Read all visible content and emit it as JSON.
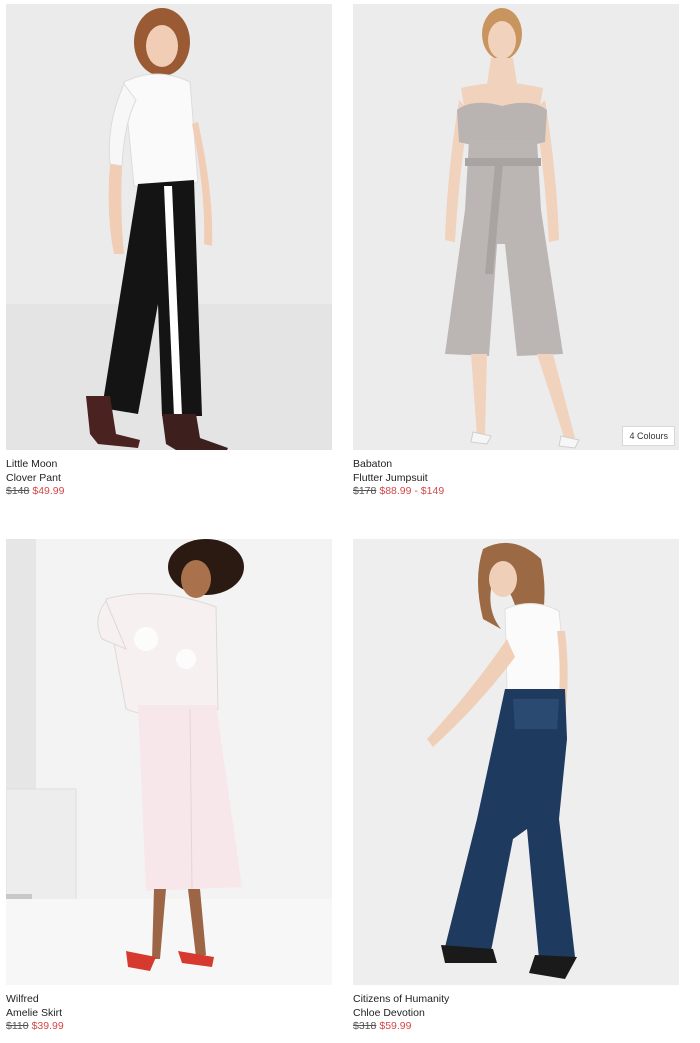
{
  "products": [
    {
      "brand": "Little Moon",
      "name": "Clover Pant",
      "old_price": "$148",
      "sale_price": "$49.99",
      "image_alt": "Woman in white knit sweater and black side-stripe wide-leg pants with brown ankle boots"
    },
    {
      "brand": "Babaton",
      "name": "Flutter Jumpsuit",
      "old_price": "$178",
      "sale_price": "$88.99 - $149",
      "badge": "4 Colours",
      "image_alt": "Woman in grey strapless ruffle jumpsuit with belt and white heeled sandals"
    },
    {
      "brand": "Wilfred",
      "name": "Amelie Skirt",
      "old_price": "$110",
      "sale_price": "$39.99",
      "image_alt": "Woman in sheer white floral blouse and pale pink button midi skirt with red mules"
    },
    {
      "brand": "Citizens of Humanity",
      "name": "Chloe Devotion",
      "old_price": "$318",
      "sale_price": "$59.99",
      "image_alt": "Woman in white ribbed tee and dark blue flared jeans with black strappy sandals"
    }
  ],
  "colors": {
    "sale": "#d4484a",
    "photo_bg": "#ececec"
  }
}
